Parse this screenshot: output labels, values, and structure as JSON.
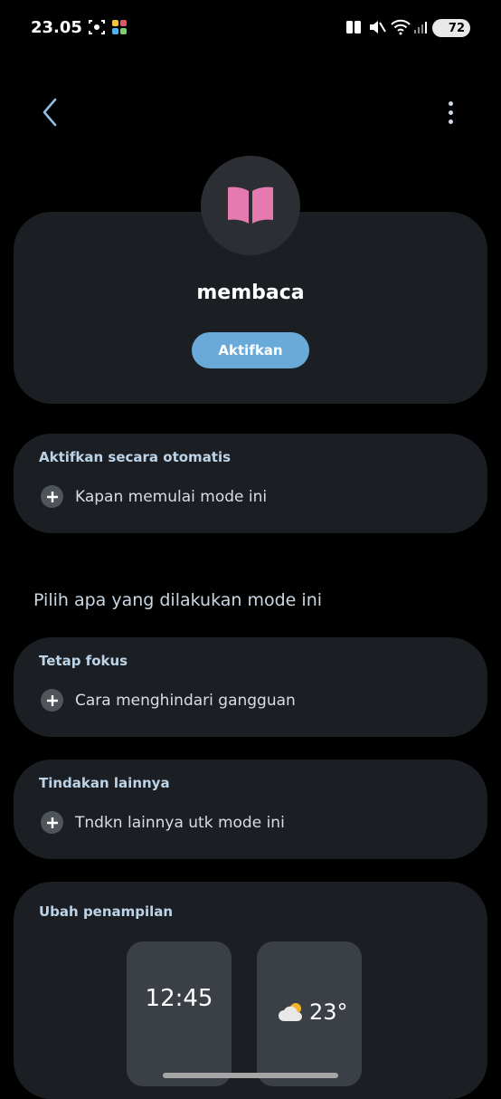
{
  "status_bar": {
    "time": "23.05",
    "battery": "72",
    "icons": [
      "screen-capture-icon",
      "app-grid-icon",
      "vibrate-icon",
      "mute-icon",
      "wifi-icon",
      "signal-icon"
    ]
  },
  "top_bar": {
    "back_icon": "chevron-left-icon",
    "more_icon": "more-vert-icon"
  },
  "mode": {
    "name": "membaca",
    "icon": "book-icon",
    "icon_color": "#e47ab0",
    "activate_label": "Aktifkan"
  },
  "auto_section": {
    "title": "Aktifkan secara otomatis",
    "item": "Kapan memulai mode ini"
  },
  "choose_heading": "Pilih apa yang dilakukan mode ini",
  "focus_section": {
    "title": "Tetap fokus",
    "item": "Cara menghindari gangguan"
  },
  "other_section": {
    "title": "Tindakan lainnya",
    "item": "Tndkn lainnya utk mode ini"
  },
  "appearance_section": {
    "title": "Ubah penampilan",
    "preview_clock": "12:45",
    "preview_weather": "23°"
  },
  "colors": {
    "background": "#000000",
    "card": "#1b1f24",
    "accent": "#6aaad8"
  }
}
